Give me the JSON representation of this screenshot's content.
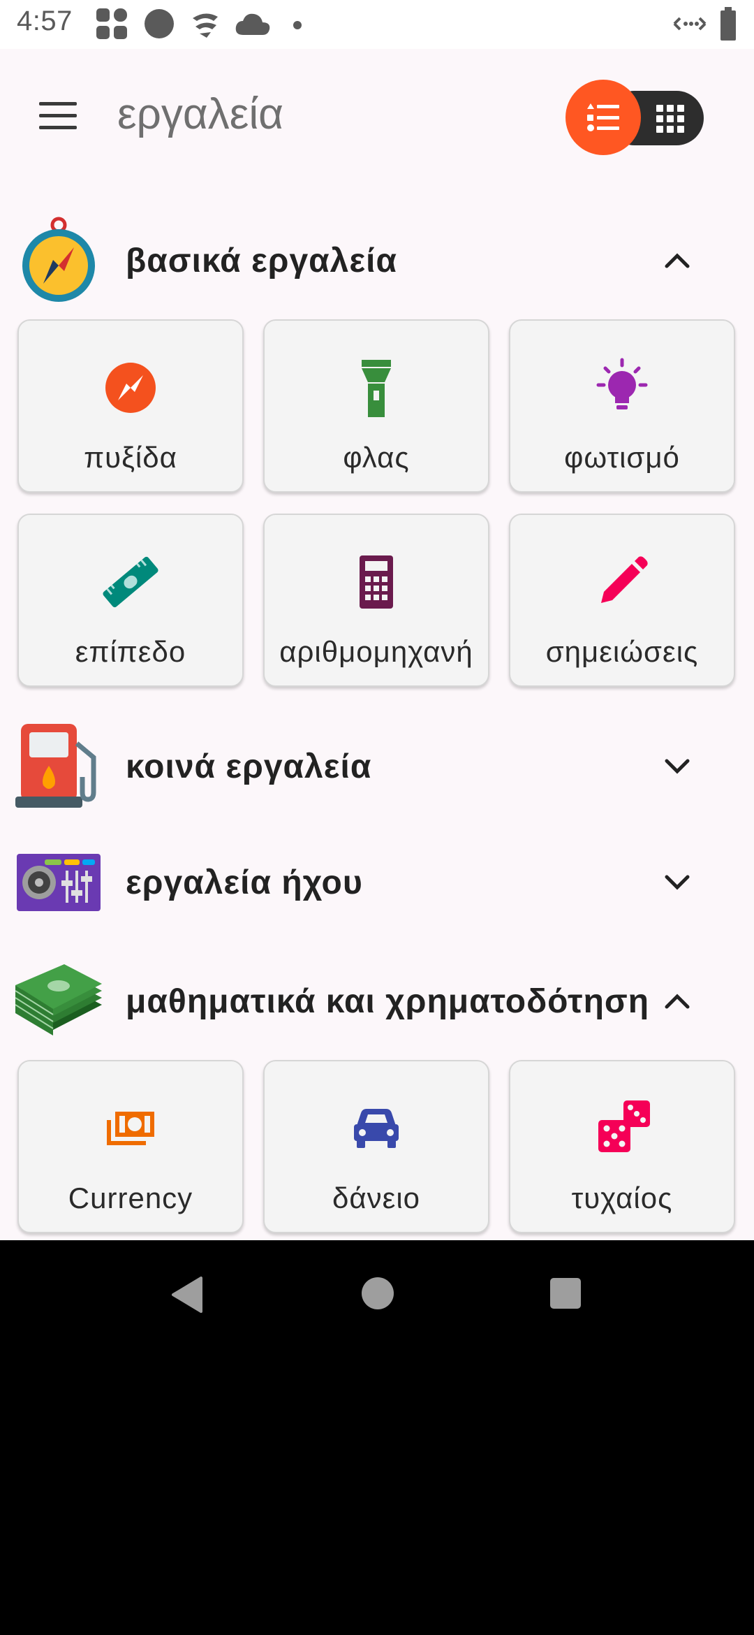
{
  "status_bar": {
    "time": "4:57"
  },
  "app_bar": {
    "title": "εργαλεία"
  },
  "sections": [
    {
      "title": "βασικά εργαλεία",
      "expanded": true,
      "items": [
        {
          "label": "πυξίδα",
          "icon": "compass-icon",
          "color": "#f4511e"
        },
        {
          "label": "φλας",
          "icon": "flashlight-icon",
          "color": "#388e3c"
        },
        {
          "label": "φωτισμό",
          "icon": "lightbulb-icon",
          "color": "#9c27b0"
        },
        {
          "label": "επίπεδο",
          "icon": "spirit-level-icon",
          "color": "#00897b"
        },
        {
          "label": "αριθμομηχανή",
          "icon": "calculator-icon",
          "color": "#6a1b4d"
        },
        {
          "label": "σημειώσεις",
          "icon": "pencil-icon",
          "color": "#f50057"
        }
      ]
    },
    {
      "title": "κοινά εργαλεία",
      "expanded": false,
      "items": []
    },
    {
      "title": "εργαλεία ήχου",
      "expanded": false,
      "items": []
    },
    {
      "title": "μαθηματικά και χρηματοδότηση",
      "expanded": true,
      "items": [
        {
          "label": "Currency",
          "icon": "money-icon",
          "color": "#ef6c00"
        },
        {
          "label": "δάνειο",
          "icon": "car-icon",
          "color": "#3949ab"
        },
        {
          "label": "τυχαίος",
          "icon": "dice-icon",
          "color": "#f50057"
        }
      ]
    }
  ],
  "colors": {
    "accent": "#ff5722",
    "background": "#fcf7fa"
  }
}
